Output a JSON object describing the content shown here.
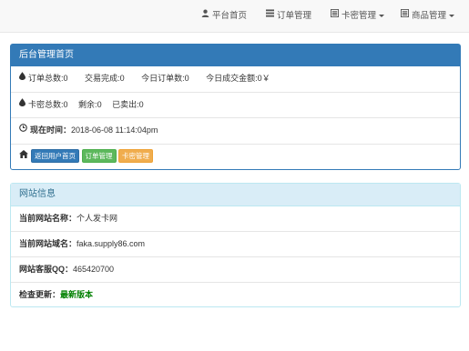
{
  "nav": {
    "items": [
      {
        "label": "平台首页",
        "icon": "user-icon"
      },
      {
        "label": "订单管理",
        "icon": "list-icon"
      },
      {
        "label": "卡密管理",
        "icon": "list-alt-icon"
      },
      {
        "label": "商品管理",
        "icon": "list-alt-icon"
      }
    ]
  },
  "admin_panel": {
    "title": "后台管理首页",
    "stats1": {
      "order_total_label": "订单总数:",
      "order_total": "0",
      "trade_done_label": "交易完成:",
      "trade_done": "0",
      "today_orders_label": "今日订单数:",
      "today_orders": "0",
      "today_amount_label": "今日成交金额:",
      "today_amount": "0",
      "currency": "￥"
    },
    "stats2": {
      "card_total_label": "卡密总数:",
      "card_total": "0",
      "remaining_label": "剩余:",
      "remaining": "0",
      "sold_label": "已卖出:",
      "sold": "0"
    },
    "time": {
      "label": "现在时间：",
      "value": "2018-06-08 11:14:04pm"
    },
    "buttons": {
      "back_home": "返回用户首页",
      "orders": "订单管理",
      "cards": "卡密管理"
    }
  },
  "site_panel": {
    "title": "网站信息",
    "rows": [
      {
        "label": "当前网站名称：",
        "value": "个人发卡网"
      },
      {
        "label": "当前网站域名：",
        "value": "faka.supply86.com"
      },
      {
        "label": "网站客服QQ：",
        "value": "465420700"
      },
      {
        "label": "检查更新：",
        "value": "最新版本"
      }
    ]
  },
  "colors": {
    "primary": "#337ab7",
    "info_bg": "#d9edf7",
    "success": "#5cb85c",
    "warning": "#f0ad4e",
    "update_ok": "#008000"
  }
}
